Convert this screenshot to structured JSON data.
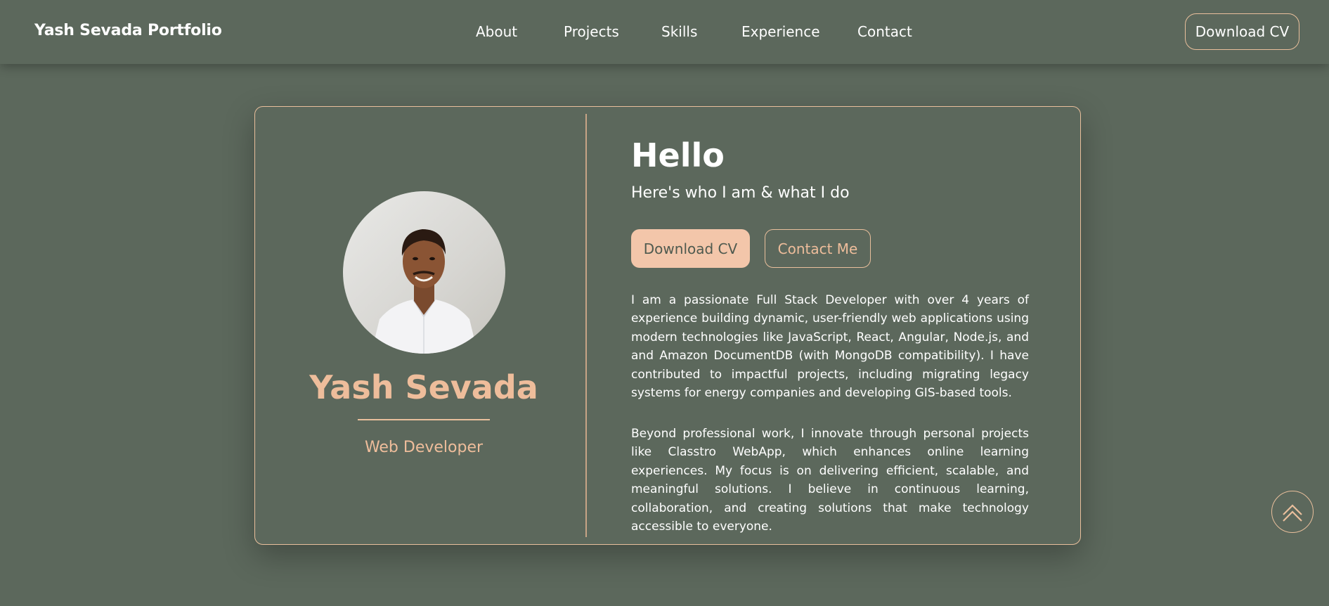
{
  "header": {
    "brand": "Yash Sevada Portfolio",
    "nav": [
      "About",
      "Projects",
      "Skills",
      "Experience",
      "Contact"
    ],
    "download_cv": "Download CV"
  },
  "profile": {
    "photo_icon": "profile-photo",
    "name": "Yash Sevada",
    "role": "Web Developer"
  },
  "intro": {
    "greeting": "Hello",
    "subtitle": "Here's who I am & what I do",
    "primary_button": "Download CV",
    "secondary_button": "Contact Me",
    "paragraphs": [
      "I am a passionate Full Stack Developer with over 4 years of experience building dynamic, user-friendly web applications using modern technologies like JavaScript, React, Angular, Node.js, and and Amazon DocumentDB (with MongoDB compatibility). I have contributed to impactful projects, including migrating legacy systems for energy companies and developing GIS-based tools.",
      "Beyond professional work, I innovate through personal projects like Classtro WebApp, which enhances online learning experiences. My focus is on delivering efficient, scalable, and meaningful solutions. I believe in continuous learning, collaboration, and creating solutions that make technology accessible to everyone."
    ]
  },
  "scroll_top_icon": "double-chevron-up-icon",
  "colors": {
    "background": "#5c685c",
    "accent": "#eebd9b",
    "border": "#e9bf9c",
    "button_fill": "#f3c6aa"
  }
}
